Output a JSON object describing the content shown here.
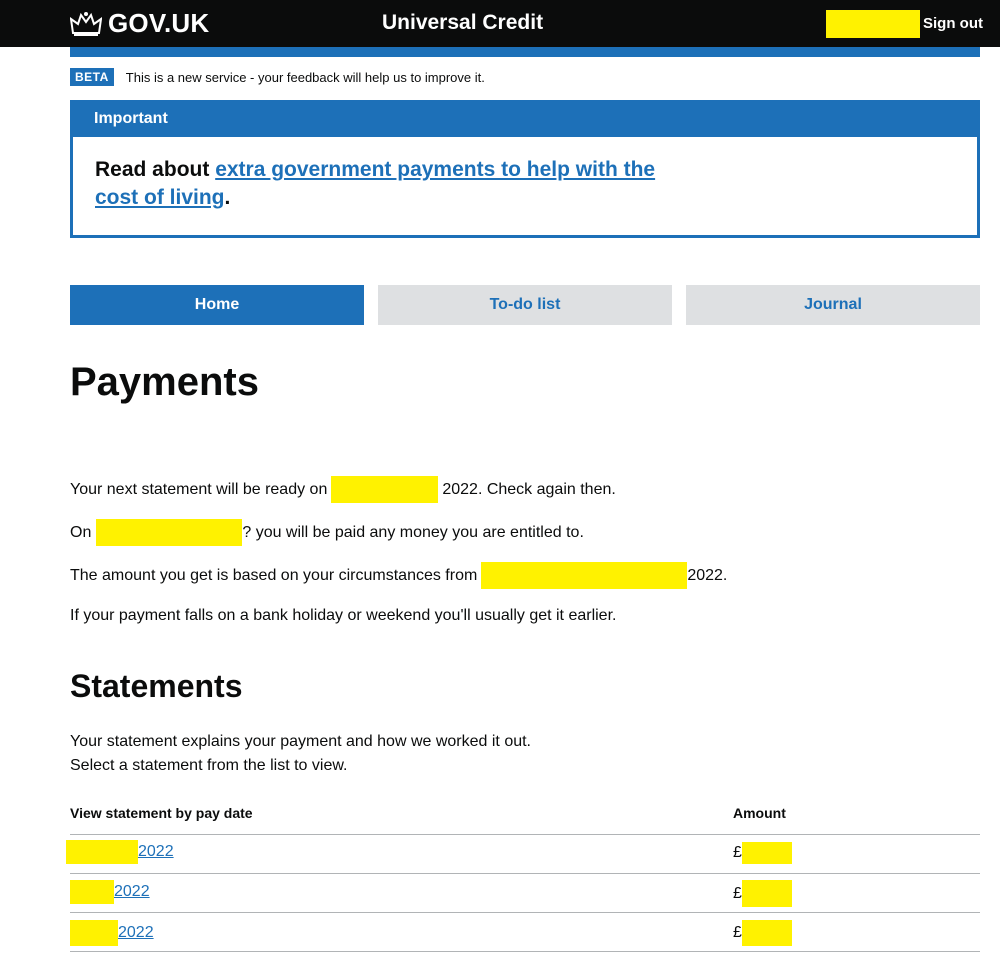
{
  "header": {
    "logo_text": "GOV.UK",
    "logo_icon": "crown-icon",
    "service_name": "Universal Credit",
    "sign_out": "Sign out"
  },
  "phase_banner": {
    "tag": "BETA",
    "text": "This is a new service - your feedback will help us to improve it."
  },
  "notification": {
    "title": "Important",
    "text_before": "Read about ",
    "link_text": "extra government payments to help with the cost of living",
    "text_after": "."
  },
  "tabs": [
    {
      "label": "Home",
      "active": true
    },
    {
      "label": "To-do list",
      "active": false
    },
    {
      "label": "Journal",
      "active": false
    }
  ],
  "payments": {
    "heading": "Payments",
    "line1_before": "Your next statement will be ready on",
    "line1_after": "2022. Check again then.",
    "line2_before": "On",
    "line2_after": "? you will be paid any money you are entitled to.",
    "line3_before": "The amount you get is based on your circumstances from",
    "line3_after": "2022.",
    "line4": "If your payment falls on a bank holiday or weekend you'll usually get it earlier."
  },
  "statements": {
    "heading": "Statements",
    "intro_line1": "Your statement explains your payment and how we worked it out.",
    "intro_line2": "Select a statement from the list to view.",
    "col_date": "View statement by pay date",
    "col_amount": "Amount",
    "currency": "£",
    "rows": [
      {
        "date_suffix": "2022"
      },
      {
        "date_suffix": "2022"
      },
      {
        "date_suffix": "2022"
      }
    ]
  },
  "colors": {
    "header": "#0b0c0c",
    "brand_blue": "#1d70b8",
    "tab_inactive": "#dee0e2",
    "redaction": "#fff200"
  }
}
